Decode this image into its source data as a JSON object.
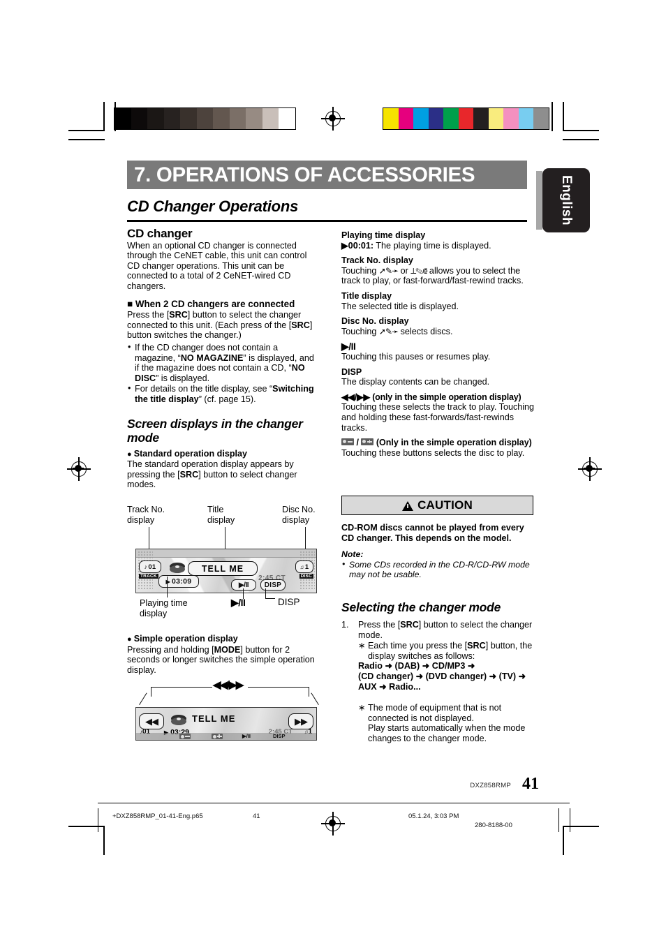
{
  "header": {
    "chapter_title": "7. OPERATIONS OF ACCESSORIES",
    "section_title": "CD Changer Operations",
    "language_tab": "English"
  },
  "left_column": {
    "h_cd_changer": "CD changer",
    "p_cd_changer": "When an optional CD changer is connected through the CeNET cable, this unit can control CD changer operations. This unit can be connected to a total of 2 CeNET-wired CD changers.",
    "h_when_2": "When 2 CD changers are connected",
    "p_when_2_a": "Press the [",
    "p_when_2_b": "SRC",
    "p_when_2_c": "] button to select the changer connected to this unit. (Each press of the [",
    "p_when_2_d": "SRC",
    "p_when_2_e": "] button switches the changer.)",
    "bullet1_a": "If the CD changer does not contain a magazine, “",
    "bullet1_b": "NO MAGAZINE",
    "bullet1_c": "” is displayed, and if the magazine does not contain a CD, “",
    "bullet1_d": "NO DISC",
    "bullet1_e": "” is displayed.",
    "bullet2_a": "For details on the title display, see “",
    "bullet2_b": "Switching the title display",
    "bullet2_c": "” (cf. page 15).",
    "h_screen_displays": "Screen displays in the changer mode",
    "h_standard": "Standard operation display",
    "p_standard_a": "The standard operation display appears by pressing the [",
    "p_standard_b": "SRC",
    "p_standard_c": "] button to select changer modes.",
    "callout_track": "Track No.\ndisplay",
    "callout_track_l1": "Track No.",
    "callout_track_l2": "display",
    "callout_title_l1": "Title",
    "callout_title_l2": "display",
    "callout_disc_l1": "Disc No.",
    "callout_disc_l2": "display",
    "callout_playtime_l1": "Playing time",
    "callout_playtime_l2": "display",
    "callout_playpause": "▶/II",
    "callout_disp": "DISP",
    "h_simple": "Simple operation display",
    "p_simple_a": "Pressing and holding [",
    "p_simple_b": "MODE",
    "p_simple_c": "] button for 2 seconds or longer switches the simple operation display.",
    "callout_ffrew": "◀◀/▶▶"
  },
  "lcd_standard": {
    "track_badge": "01",
    "track_label": "TRACK",
    "title": "TELL  ME",
    "disc_badge": "1",
    "disc_label": "DISC",
    "play_time": "03:09",
    "clock": "2:45 CT",
    "playpause_btn": "▶/II",
    "disp_btn": "DISP"
  },
  "lcd_simple": {
    "track_badge": "01",
    "title": "TELL  ME",
    "disc_badge": "1",
    "play_time": "03:29",
    "clock": "2:45 CT",
    "rew_btn": "◀◀",
    "ff_btn": "▶▶",
    "playpause_btn": "▶/II",
    "disp_btn": "DISP"
  },
  "right_column": {
    "h_playing_time": "Playing time display",
    "p_playing_time_b": "▶00:01:",
    "p_playing_time": " The playing time is displayed.",
    "h_track_no": "Track No. display",
    "p_track_no_a": "Touching ",
    "p_track_no_b": " or ",
    "p_track_no_c": " allows you to select the track to play, or fast-forward/fast-rewind tracks.",
    "h_title": "Title display",
    "p_title": "The selected title is displayed.",
    "h_disc_no": "Disc No. display",
    "p_disc_no_a": "Touching ",
    "p_disc_no_b": " selects discs.",
    "h_playpause": "▶/II",
    "p_playpause": "Touching this pauses or resumes play.",
    "h_disp": "DISP",
    "p_disp": "The display contents can be changed.",
    "h_ffrew": "◀◀/▶▶ (only in the simple operation display)",
    "p_ffrew": "Touching these selects the track to play. Touching and holding these fast-forwards/fast-rewinds tracks.",
    "h_discsel": " (Only in the simple operation display)",
    "h_discsel_sep": " / ",
    "p_discsel": "Touching these buttons selects the disc to play."
  },
  "caution": {
    "heading": "CAUTION",
    "body": "CD-ROM discs cannot be played from every CD changer. This depends on the model.",
    "note_label": "Note:",
    "note_item": "Some CDs recorded in the CD-R/CD-RW mode may not be usable."
  },
  "selecting_mode": {
    "heading": "Selecting the changer mode",
    "step_num": "1.",
    "step_a": "Press the [",
    "step_b": "SRC",
    "step_c": "] button to select the changer mode.",
    "sub1_a": "Each time you press the [",
    "sub1_b": "SRC",
    "sub1_c": "] button, the display switches as follows:",
    "sequence_line1": "Radio ➜ (DAB) ➜ CD/MP3 ➜",
    "sequence_line2": "(CD changer) ➜ (DVD changer) ➜ (TV) ➜",
    "sequence_line3": "AUX ➜ Radio...",
    "sub2": "The mode of equipment that is not connected is not displayed.\nPlay starts automatically when the mode changes to the changer mode.",
    "sub2_l1": "The mode of equipment that is not connected is not displayed.",
    "sub2_l2": "Play starts automatically when the mode changes to the changer mode."
  },
  "footer": {
    "model": "DXZ858RMP",
    "page_number": "41",
    "file_name": "+DXZ858RMP_01-41-Eng.p65",
    "page_ref": "41",
    "date": "05.1.24, 3:03 PM",
    "doc_code": "280-8188-00"
  },
  "colors": {
    "title_bar_gray": "#7a7a7a",
    "caution_gray": "#d9d9d9",
    "tab_black": "#231f20",
    "gray_ramp": [
      "#000000",
      "#0d0a0a",
      "#1b1715",
      "#272220",
      "#39312c",
      "#4d433d",
      "#63574f",
      "#7b6f67",
      "#978b83",
      "#c9bfb9",
      "#ffffff"
    ],
    "color_patches": [
      "#f6e400",
      "#e6007e",
      "#00a0e2",
      "#2b2f87",
      "#00a04b",
      "#e8272b",
      "#231f20",
      "#f9ec7e",
      "#f490bf",
      "#78cdf0",
      "#8e8e8e"
    ]
  }
}
